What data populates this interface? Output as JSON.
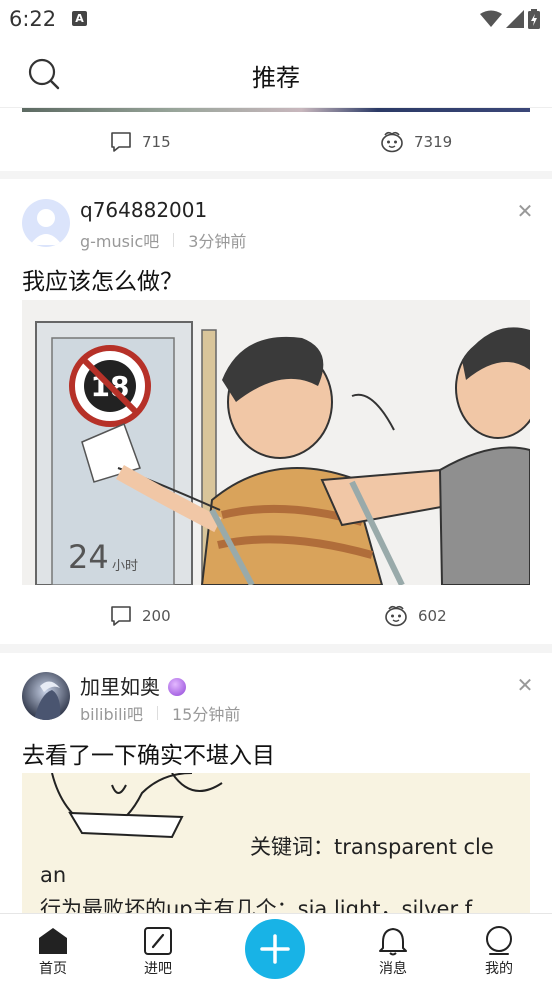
{
  "status_bar": {
    "time": "6:22",
    "notif_icon": "A"
  },
  "header": {
    "title": "推荐",
    "search_icon": "search-icon"
  },
  "posts": [
    {
      "comments": "715",
      "likes": "7319"
    },
    {
      "username": "q764882001",
      "forum": "g-music吧",
      "time": "3分钟前",
      "title": "我应该怎么做？",
      "comments": "200",
      "likes": "602",
      "image_text": "24小时"
    },
    {
      "username": "加里如奥",
      "forum": "bilibili吧",
      "time": "15分钟前",
      "title": "去看了一下确实不堪入目",
      "image_lines": [
        "关键词：transparent cle",
        "an",
        "行为最败坏的up主有几个：sia light，silver f"
      ]
    }
  ],
  "nav": {
    "home": "首页",
    "forum": "进吧",
    "messages": "消息",
    "mine": "我的"
  },
  "colors": {
    "accent": "#18b3e6"
  }
}
